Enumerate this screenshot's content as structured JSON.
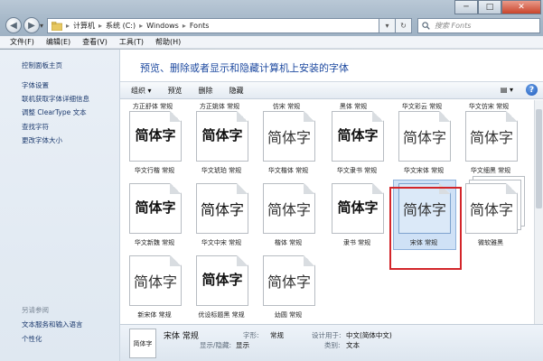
{
  "window": {
    "controls": {
      "minimize": "─",
      "maximize": "□",
      "close": "✕"
    },
    "nav": {
      "back": "◀",
      "forward": "▶",
      "dropdown": "▾"
    },
    "address": {
      "crumbs": [
        "计算机",
        "系统 (C:)",
        "Windows",
        "Fonts"
      ],
      "separator": "▸"
    },
    "address_buttons": {
      "history": "▾",
      "refresh": "↻"
    },
    "search_placeholder": "搜索 Fonts"
  },
  "menubar": [
    "文件(F)",
    "编辑(E)",
    "查看(V)",
    "工具(T)",
    "帮助(H)"
  ],
  "sidebar": {
    "home": "控制面板主页",
    "links": [
      "字体设置",
      "联机获取字体详细信息",
      "调整 ClearType 文本",
      "查找字符",
      "更改字体大小"
    ],
    "see_also_title": "另请参阅",
    "see_also": [
      "文本服务和输入语言",
      "个性化"
    ]
  },
  "main": {
    "heading": "预览、删除或者显示和隐藏计算机上安装的字体",
    "toolbar": {
      "organize": "组织 ▾",
      "preview": "预览",
      "delete": "删除",
      "hide": "隐藏",
      "view": "▤ ▾",
      "help": "?"
    },
    "top_row_labels": [
      "方正舒体 常规",
      "方正姚体 常规",
      "仿宋 常规",
      "黑体 常规",
      "华文彩云 常规",
      "华文仿宋 常规"
    ],
    "fonts": [
      {
        "sample": "简体字",
        "label": "华文行楷 常规",
        "style": "bold"
      },
      {
        "sample": "简体字",
        "label": "华文琥珀 常规",
        "style": "bold"
      },
      {
        "sample": "简体字",
        "label": "华文楷体 常规",
        "style": "light"
      },
      {
        "sample": "简体字",
        "label": "华文隶书 常规",
        "style": "bold"
      },
      {
        "sample": "简体字",
        "label": "华文宋体 常规",
        "style": "light"
      },
      {
        "sample": "简体字",
        "label": "华文细黑 常规",
        "style": "light"
      },
      {
        "sample": "简体字",
        "label": "华文新魏 常规",
        "style": "bold"
      },
      {
        "sample": "简体字",
        "label": "华文中宋 常规",
        "style": "serif"
      },
      {
        "sample": "简体字",
        "label": "楷体 常规",
        "style": "light"
      },
      {
        "sample": "简体字",
        "label": "隶书 常规",
        "style": "bold"
      },
      {
        "sample": "简体字",
        "label": "宋体 常规",
        "style": "light",
        "selected": true
      },
      {
        "sample": "简体字",
        "label": "微软雅黑",
        "style": "light",
        "stack": true
      },
      {
        "sample": "简体字",
        "label": "新宋体 常规",
        "style": "light"
      },
      {
        "sample": "简体字",
        "label": "优设标题黑 常规",
        "style": "bold"
      },
      {
        "sample": "简体字",
        "label": "幼圆 常规",
        "style": "light"
      }
    ]
  },
  "details": {
    "thumb": "简体字",
    "name": "宋体 常规",
    "style_key": "字形:",
    "style_val": "常规",
    "show_key": "显示/隐藏:",
    "show_val": "显示",
    "design_key": "设计用于:",
    "design_val": "中文(简体中文)",
    "category_key": "类别:",
    "category_val": "文本"
  }
}
